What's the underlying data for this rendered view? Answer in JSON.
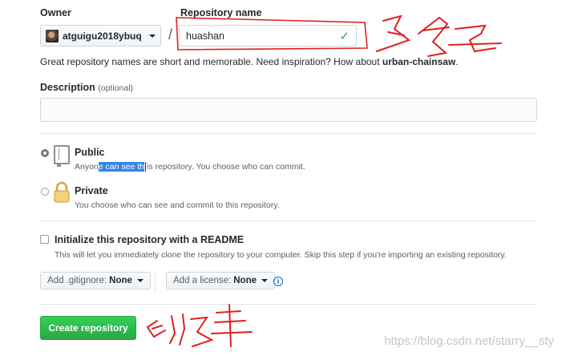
{
  "owner": {
    "label": "Owner",
    "value": "atguigu2018ybuq"
  },
  "repo_name": {
    "label": "Repository name",
    "value": "huashan",
    "check_icon": "check-icon",
    "hint_prefix": "Great repository names are short and memorable. Need inspiration? How about",
    "suggestion": "urban-chainsaw",
    "hint_suffix": "."
  },
  "description": {
    "label": "Description",
    "optional": "(optional)",
    "value": ""
  },
  "visibility": {
    "public": {
      "label": "Public",
      "desc_before": "Anyon",
      "desc_selected": "e can see th",
      "desc_after": "is repository. You choose who can commit.",
      "selected": true
    },
    "private": {
      "label": "Private",
      "desc": "You choose who can see and commit to this repository.",
      "selected": false
    }
  },
  "readme": {
    "label": "Initialize this repository with a README",
    "desc": "This will let you immediately clone the repository to your computer. Skip this step if you're importing an existing repository.",
    "checked": false
  },
  "gitignore": {
    "label": "Add .gitignore:",
    "value": "None"
  },
  "license": {
    "label": "Add a license:",
    "value": "None"
  },
  "create_button": "Create repository",
  "annotations": {
    "color": "#e02020",
    "note_repo_name": "名字",
    "note_create": "创建"
  },
  "watermark": "https://blog.csdn.net/starry__sty"
}
